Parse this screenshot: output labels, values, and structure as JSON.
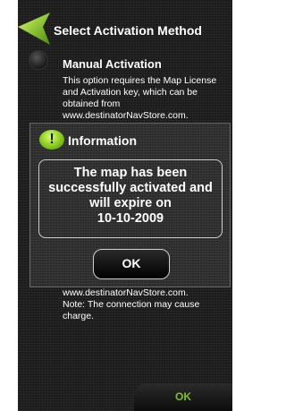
{
  "header": {
    "title": "Select Activation Method"
  },
  "manual_option": {
    "title": "Manual Activation",
    "description_lines": [
      "This option requires the Map License",
      "and Activation key, which can be",
      "obtained from",
      "www.destinatorNavStore.com."
    ]
  },
  "second_option": {
    "description_lines": [
      "www.destinatorNavStore.com.",
      "Note: The connection may cause",
      "charge."
    ]
  },
  "dialog": {
    "icon_glyph": "!",
    "title": "Information",
    "message_lines": [
      "The map has been",
      "successfully activated and",
      "will expire on",
      "10-10-2009"
    ],
    "ok_label": "OK"
  },
  "footer": {
    "ok_label": "OK"
  },
  "colors": {
    "accent_green": "#7ec31a",
    "background": "#1b1b1b"
  }
}
